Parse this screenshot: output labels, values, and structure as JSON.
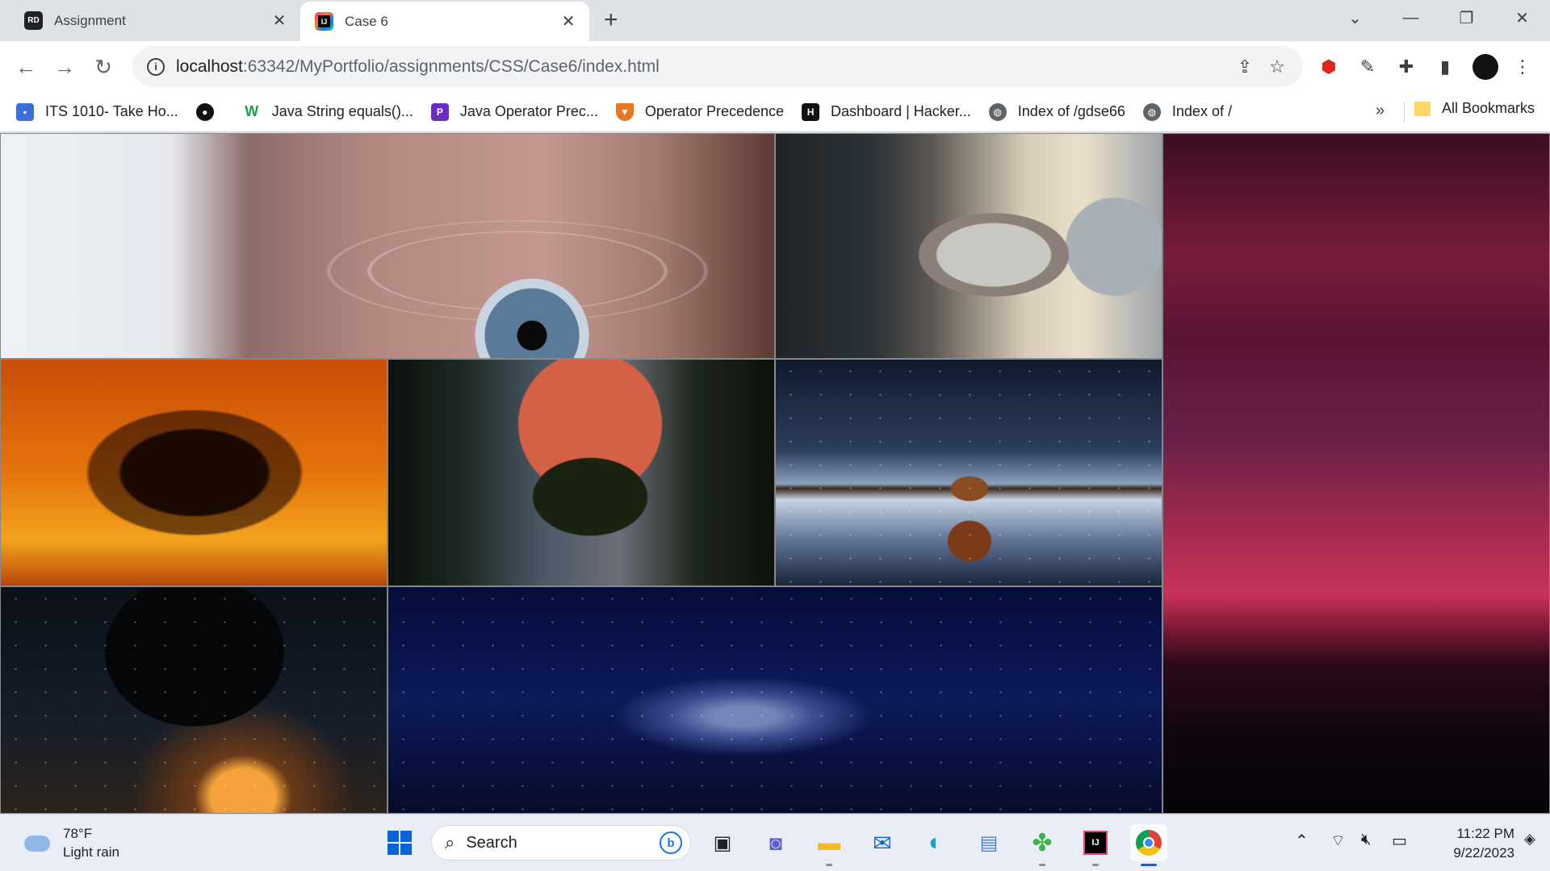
{
  "tabs": [
    {
      "favicon": "RD",
      "title": "Assignment",
      "active": false
    },
    {
      "favicon": "IJ",
      "title": "Case 6",
      "active": true
    }
  ],
  "toolbar": {
    "url_host": "localhost",
    "url_path": ":63342/MyPortfolio/assignments/CSS/Case6/index.html"
  },
  "bookmarks": [
    {
      "icon": "user-card-icon",
      "label": "ITS 1010- Take Ho..."
    },
    {
      "icon": "github-icon",
      "label": ""
    },
    {
      "icon": "w3-icon",
      "label": "Java String equals()..."
    },
    {
      "icon": "programiz-icon",
      "label": "Java Operator Prec..."
    },
    {
      "icon": "princeton-icon",
      "label": "Operator Precedence"
    },
    {
      "icon": "hackerrank-icon",
      "label": "Dashboard | Hacker..."
    },
    {
      "icon": "globe-icon",
      "label": "Index of /gdse66"
    },
    {
      "icon": "globe-icon",
      "label": "Index of /"
    }
  ],
  "bookmarks_more": "»",
  "all_bookmarks_label": "All Bookmarks",
  "weather": {
    "temp": "78°F",
    "condition": "Light rain"
  },
  "taskbar_search_placeholder": "Search",
  "clock": {
    "time": "11:22 PM",
    "date": "9/22/2023"
  },
  "colors": {
    "accent": "#0a64d8",
    "tabstrip": "#dee1e6",
    "taskbar": "#e9eef6"
  }
}
